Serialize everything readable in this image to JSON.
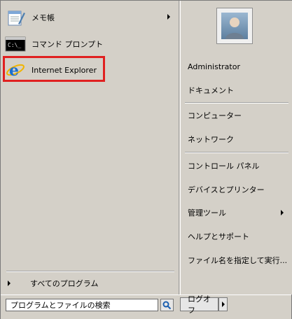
{
  "programs": [
    {
      "label": "メモ帳",
      "icon": "notepad-icon",
      "has_submenu": true
    },
    {
      "label": "コマンド プロンプト",
      "icon": "command-prompt-icon",
      "has_submenu": false
    },
    {
      "label": "Internet Explorer",
      "icon": "internet-explorer-icon",
      "has_submenu": false
    }
  ],
  "all_programs_label": "すべてのプログラム",
  "search": {
    "placeholder": "プログラムとファイルの検索"
  },
  "logoff_label": "ログオフ",
  "right_menu": {
    "user": "Administrator",
    "items": [
      {
        "label": "ドキュメント"
      },
      {
        "label": "コンピューター"
      },
      {
        "label": "ネットワーク"
      },
      {
        "label": "コントロール パネル"
      },
      {
        "label": "デバイスとプリンター"
      },
      {
        "label": "管理ツール",
        "has_submenu": true
      },
      {
        "label": "ヘルプとサポート"
      },
      {
        "label": "ファイル名を指定して実行..."
      }
    ]
  },
  "colors": {
    "highlight_border": "#e02020",
    "background": "#d4d0c8"
  }
}
